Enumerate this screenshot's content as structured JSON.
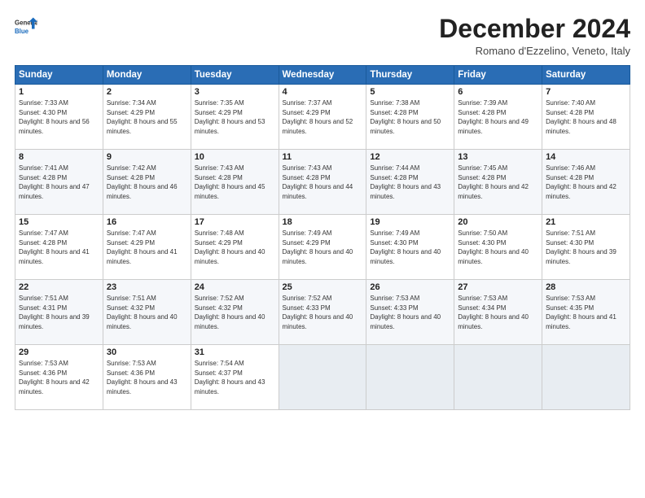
{
  "logo": {
    "general": "General",
    "blue": "Blue"
  },
  "title": "December 2024",
  "location": "Romano d'Ezzelino, Veneto, Italy",
  "header_days": [
    "Sunday",
    "Monday",
    "Tuesday",
    "Wednesday",
    "Thursday",
    "Friday",
    "Saturday"
  ],
  "weeks": [
    [
      {
        "day": "1",
        "sunrise": "Sunrise: 7:33 AM",
        "sunset": "Sunset: 4:30 PM",
        "daylight": "Daylight: 8 hours and 56 minutes."
      },
      {
        "day": "2",
        "sunrise": "Sunrise: 7:34 AM",
        "sunset": "Sunset: 4:29 PM",
        "daylight": "Daylight: 8 hours and 55 minutes."
      },
      {
        "day": "3",
        "sunrise": "Sunrise: 7:35 AM",
        "sunset": "Sunset: 4:29 PM",
        "daylight": "Daylight: 8 hours and 53 minutes."
      },
      {
        "day": "4",
        "sunrise": "Sunrise: 7:37 AM",
        "sunset": "Sunset: 4:29 PM",
        "daylight": "Daylight: 8 hours and 52 minutes."
      },
      {
        "day": "5",
        "sunrise": "Sunrise: 7:38 AM",
        "sunset": "Sunset: 4:28 PM",
        "daylight": "Daylight: 8 hours and 50 minutes."
      },
      {
        "day": "6",
        "sunrise": "Sunrise: 7:39 AM",
        "sunset": "Sunset: 4:28 PM",
        "daylight": "Daylight: 8 hours and 49 minutes."
      },
      {
        "day": "7",
        "sunrise": "Sunrise: 7:40 AM",
        "sunset": "Sunset: 4:28 PM",
        "daylight": "Daylight: 8 hours and 48 minutes."
      }
    ],
    [
      {
        "day": "8",
        "sunrise": "Sunrise: 7:41 AM",
        "sunset": "Sunset: 4:28 PM",
        "daylight": "Daylight: 8 hours and 47 minutes."
      },
      {
        "day": "9",
        "sunrise": "Sunrise: 7:42 AM",
        "sunset": "Sunset: 4:28 PM",
        "daylight": "Daylight: 8 hours and 46 minutes."
      },
      {
        "day": "10",
        "sunrise": "Sunrise: 7:43 AM",
        "sunset": "Sunset: 4:28 PM",
        "daylight": "Daylight: 8 hours and 45 minutes."
      },
      {
        "day": "11",
        "sunrise": "Sunrise: 7:43 AM",
        "sunset": "Sunset: 4:28 PM",
        "daylight": "Daylight: 8 hours and 44 minutes."
      },
      {
        "day": "12",
        "sunrise": "Sunrise: 7:44 AM",
        "sunset": "Sunset: 4:28 PM",
        "daylight": "Daylight: 8 hours and 43 minutes."
      },
      {
        "day": "13",
        "sunrise": "Sunrise: 7:45 AM",
        "sunset": "Sunset: 4:28 PM",
        "daylight": "Daylight: 8 hours and 42 minutes."
      },
      {
        "day": "14",
        "sunrise": "Sunrise: 7:46 AM",
        "sunset": "Sunset: 4:28 PM",
        "daylight": "Daylight: 8 hours and 42 minutes."
      }
    ],
    [
      {
        "day": "15",
        "sunrise": "Sunrise: 7:47 AM",
        "sunset": "Sunset: 4:28 PM",
        "daylight": "Daylight: 8 hours and 41 minutes."
      },
      {
        "day": "16",
        "sunrise": "Sunrise: 7:47 AM",
        "sunset": "Sunset: 4:29 PM",
        "daylight": "Daylight: 8 hours and 41 minutes."
      },
      {
        "day": "17",
        "sunrise": "Sunrise: 7:48 AM",
        "sunset": "Sunset: 4:29 PM",
        "daylight": "Daylight: 8 hours and 40 minutes."
      },
      {
        "day": "18",
        "sunrise": "Sunrise: 7:49 AM",
        "sunset": "Sunset: 4:29 PM",
        "daylight": "Daylight: 8 hours and 40 minutes."
      },
      {
        "day": "19",
        "sunrise": "Sunrise: 7:49 AM",
        "sunset": "Sunset: 4:30 PM",
        "daylight": "Daylight: 8 hours and 40 minutes."
      },
      {
        "day": "20",
        "sunrise": "Sunrise: 7:50 AM",
        "sunset": "Sunset: 4:30 PM",
        "daylight": "Daylight: 8 hours and 40 minutes."
      },
      {
        "day": "21",
        "sunrise": "Sunrise: 7:51 AM",
        "sunset": "Sunset: 4:30 PM",
        "daylight": "Daylight: 8 hours and 39 minutes."
      }
    ],
    [
      {
        "day": "22",
        "sunrise": "Sunrise: 7:51 AM",
        "sunset": "Sunset: 4:31 PM",
        "daylight": "Daylight: 8 hours and 39 minutes."
      },
      {
        "day": "23",
        "sunrise": "Sunrise: 7:51 AM",
        "sunset": "Sunset: 4:32 PM",
        "daylight": "Daylight: 8 hours and 40 minutes."
      },
      {
        "day": "24",
        "sunrise": "Sunrise: 7:52 AM",
        "sunset": "Sunset: 4:32 PM",
        "daylight": "Daylight: 8 hours and 40 minutes."
      },
      {
        "day": "25",
        "sunrise": "Sunrise: 7:52 AM",
        "sunset": "Sunset: 4:33 PM",
        "daylight": "Daylight: 8 hours and 40 minutes."
      },
      {
        "day": "26",
        "sunrise": "Sunrise: 7:53 AM",
        "sunset": "Sunset: 4:33 PM",
        "daylight": "Daylight: 8 hours and 40 minutes."
      },
      {
        "day": "27",
        "sunrise": "Sunrise: 7:53 AM",
        "sunset": "Sunset: 4:34 PM",
        "daylight": "Daylight: 8 hours and 40 minutes."
      },
      {
        "day": "28",
        "sunrise": "Sunrise: 7:53 AM",
        "sunset": "Sunset: 4:35 PM",
        "daylight": "Daylight: 8 hours and 41 minutes."
      }
    ],
    [
      {
        "day": "29",
        "sunrise": "Sunrise: 7:53 AM",
        "sunset": "Sunset: 4:36 PM",
        "daylight": "Daylight: 8 hours and 42 minutes."
      },
      {
        "day": "30",
        "sunrise": "Sunrise: 7:53 AM",
        "sunset": "Sunset: 4:36 PM",
        "daylight": "Daylight: 8 hours and 43 minutes."
      },
      {
        "day": "31",
        "sunrise": "Sunrise: 7:54 AM",
        "sunset": "Sunset: 4:37 PM",
        "daylight": "Daylight: 8 hours and 43 minutes."
      },
      null,
      null,
      null,
      null
    ]
  ]
}
